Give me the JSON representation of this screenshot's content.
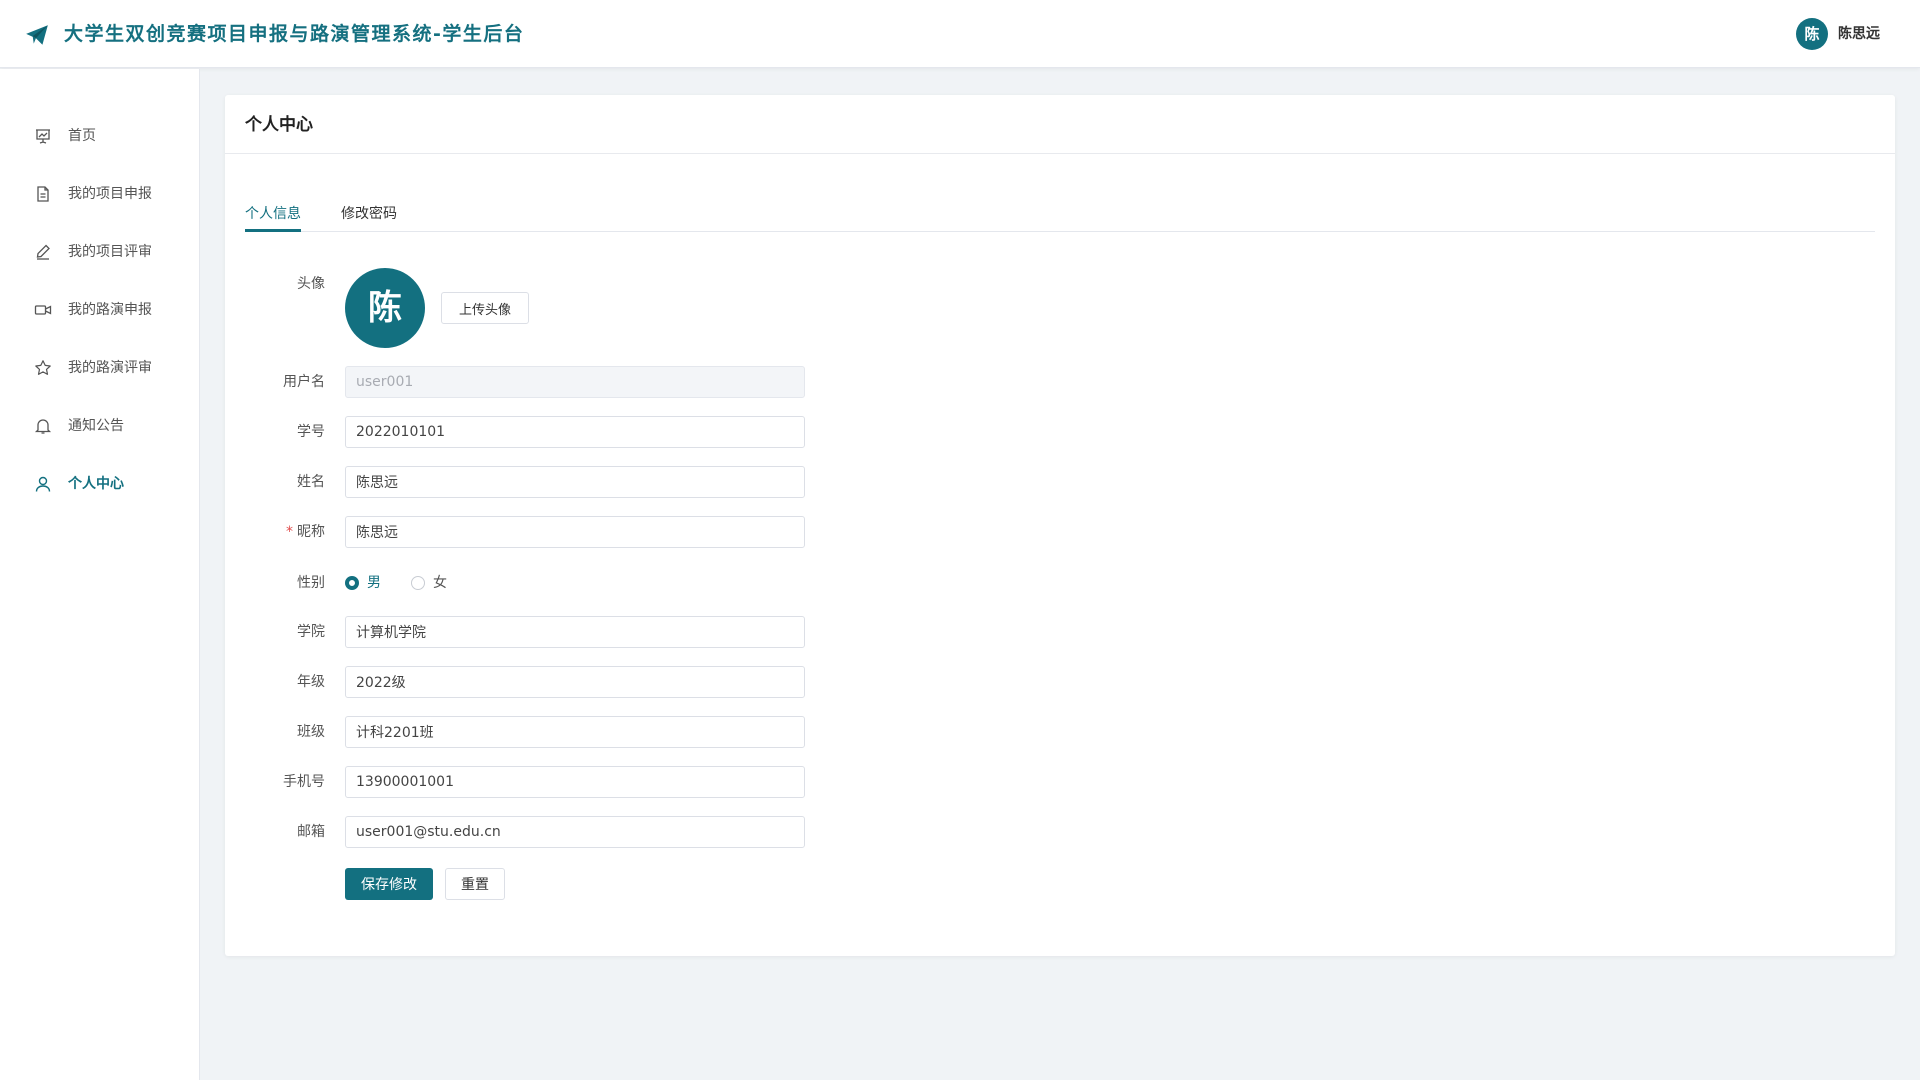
{
  "header": {
    "app_title": "大学生双创竞赛项目申报与路演管理系统-学生后台",
    "user_avatar_char": "陈",
    "user_name": "陈思远"
  },
  "sidebar": {
    "items": [
      {
        "label": "首页",
        "icon": "presentation-chart-icon",
        "active": false
      },
      {
        "label": "我的项目申报",
        "icon": "document-icon",
        "active": false
      },
      {
        "label": "我的项目评审",
        "icon": "pen-icon",
        "active": false
      },
      {
        "label": "我的路演申报",
        "icon": "video-camera-icon",
        "active": false
      },
      {
        "label": "我的路演评审",
        "icon": "star-icon",
        "active": false
      },
      {
        "label": "通知公告",
        "icon": "bell-icon",
        "active": false
      },
      {
        "label": "个人中心",
        "icon": "user-icon",
        "active": true
      }
    ]
  },
  "page": {
    "title": "个人中心",
    "tabs": [
      {
        "label": "个人信息",
        "active": true
      },
      {
        "label": "修改密码",
        "active": false
      }
    ]
  },
  "form": {
    "avatar": {
      "label": "头像",
      "char": "陈",
      "upload_label": "上传头像"
    },
    "username": {
      "label": "用户名",
      "value": "user001",
      "disabled": true
    },
    "student_id": {
      "label": "学号",
      "value": "2022010101"
    },
    "name": {
      "label": "姓名",
      "value": "陈思远"
    },
    "nickname": {
      "label": "昵称",
      "required_mark": "*",
      "value": "陈思远"
    },
    "gender": {
      "label": "性别",
      "options": [
        "男",
        "女"
      ],
      "selected": "男"
    },
    "college": {
      "label": "学院",
      "value": "计算机学院"
    },
    "grade": {
      "label": "年级",
      "value": "2022级"
    },
    "class": {
      "label": "班级",
      "value": "计科2201班"
    },
    "phone": {
      "label": "手机号",
      "value": "13900001001"
    },
    "email": {
      "label": "邮箱",
      "value": "user001@stu.edu.cn"
    },
    "save_label": "保存修改",
    "reset_label": "重置"
  },
  "colors": {
    "primary": "#137080",
    "background": "#f0f3f6",
    "required": "#e04b4b"
  }
}
